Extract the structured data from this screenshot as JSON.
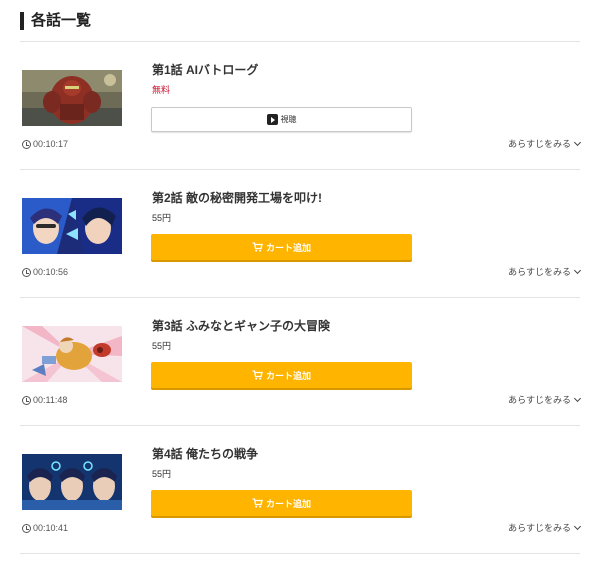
{
  "section": {
    "title": "各話一覧"
  },
  "episodes": [
    {
      "title": "第1話 AIバトローグ",
      "price": "無料",
      "price_is_free": true,
      "action": "watch",
      "button_label": "視聴",
      "duration": "00:10:17",
      "synopsis_label": "あらすじをみる",
      "thumb_icon": "mecha-thumbnail"
    },
    {
      "title": "第2話 敵の秘密開発工場を叩け!",
      "price": "55円",
      "price_is_free": false,
      "action": "cart",
      "button_label": "カート追加",
      "duration": "00:10:56",
      "synopsis_label": "あらすじをみる",
      "thumb_icon": "characters-thumbnail"
    },
    {
      "title": "第3話 ふみなとギャン子の大冒険",
      "price": "55円",
      "price_is_free": false,
      "action": "cart",
      "button_label": "カート追加",
      "duration": "00:11:48",
      "synopsis_label": "あらすじをみる",
      "thumb_icon": "adventure-thumbnail"
    },
    {
      "title": "第4話 俺たちの戦争",
      "price": "55円",
      "price_is_free": false,
      "action": "cart",
      "button_label": "カート追加",
      "duration": "00:10:41",
      "synopsis_label": "あらすじをみる",
      "thumb_icon": "trio-thumbnail"
    }
  ],
  "colors": {
    "cart_button": "#ffb400",
    "free_price": "#c8102e",
    "heading_bar": "#222222"
  }
}
